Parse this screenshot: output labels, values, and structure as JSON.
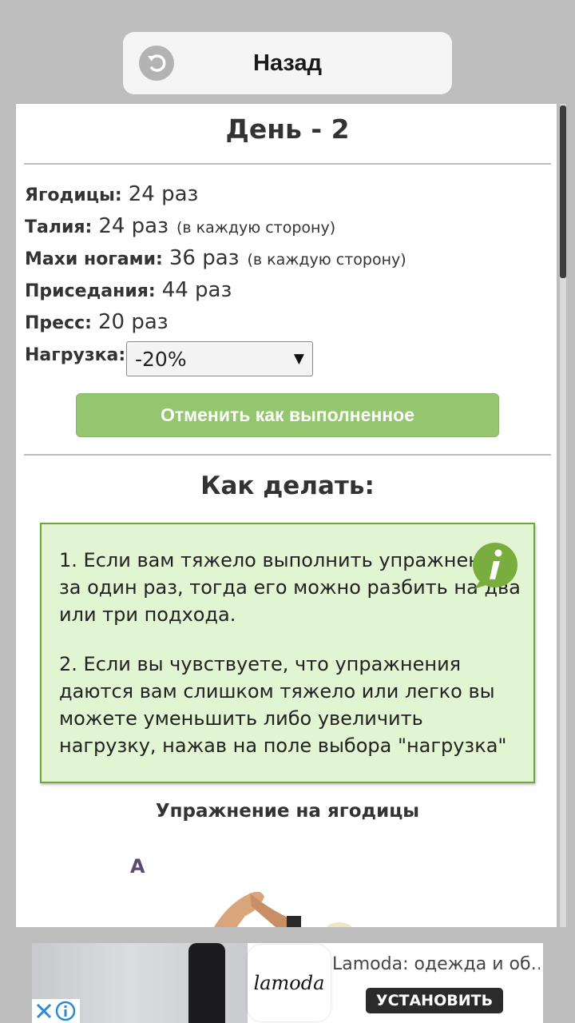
{
  "nav": {
    "back_label": "Назад",
    "back_icon": "undo-arrow-icon"
  },
  "day": {
    "title": "День - 2"
  },
  "stats": [
    {
      "label": "Ягодицы:",
      "value": "24 раз",
      "note": ""
    },
    {
      "label": "Талия:",
      "value": "24 раз",
      "note": "(в каждую сторону)"
    },
    {
      "label": "Махи ногами:",
      "value": "36 раз",
      "note": "(в каждую сторону)"
    },
    {
      "label": "Приседания:",
      "value": "44 раз",
      "note": ""
    },
    {
      "label": "Пресс:",
      "value": "20 раз",
      "note": ""
    }
  ],
  "load": {
    "label": "Нагрузка:",
    "selected": "-20%"
  },
  "done_button": {
    "label": "Отменить как выполненное"
  },
  "howto": {
    "title": "Как делать:",
    "tips": [
      "1. Если вам тяжело выполнить упражнение за один раз, тогда его можно разбить на два или три подхода.",
      "2. Если вы чувствуете, что упражнения даются вам слишком тяжело или легко вы можете уменьшить либо увеличить нагрузку, нажав на поле выбора \"нагрузка\""
    ],
    "icon": "info-speech-bubble-icon"
  },
  "exercise": {
    "title": "Упражнение на ягодицы",
    "step_letter": "A"
  },
  "ad": {
    "logo_text": "lamoda",
    "title": "Lamoda: одежда и об…",
    "cta": "УСТАНОВИТЬ"
  },
  "colors": {
    "background": "#bdbdbd",
    "button_green": "#93c66e",
    "info_bg": "#e1f5d2",
    "info_border": "#6aa83c",
    "info_icon": "#79ae3f"
  }
}
